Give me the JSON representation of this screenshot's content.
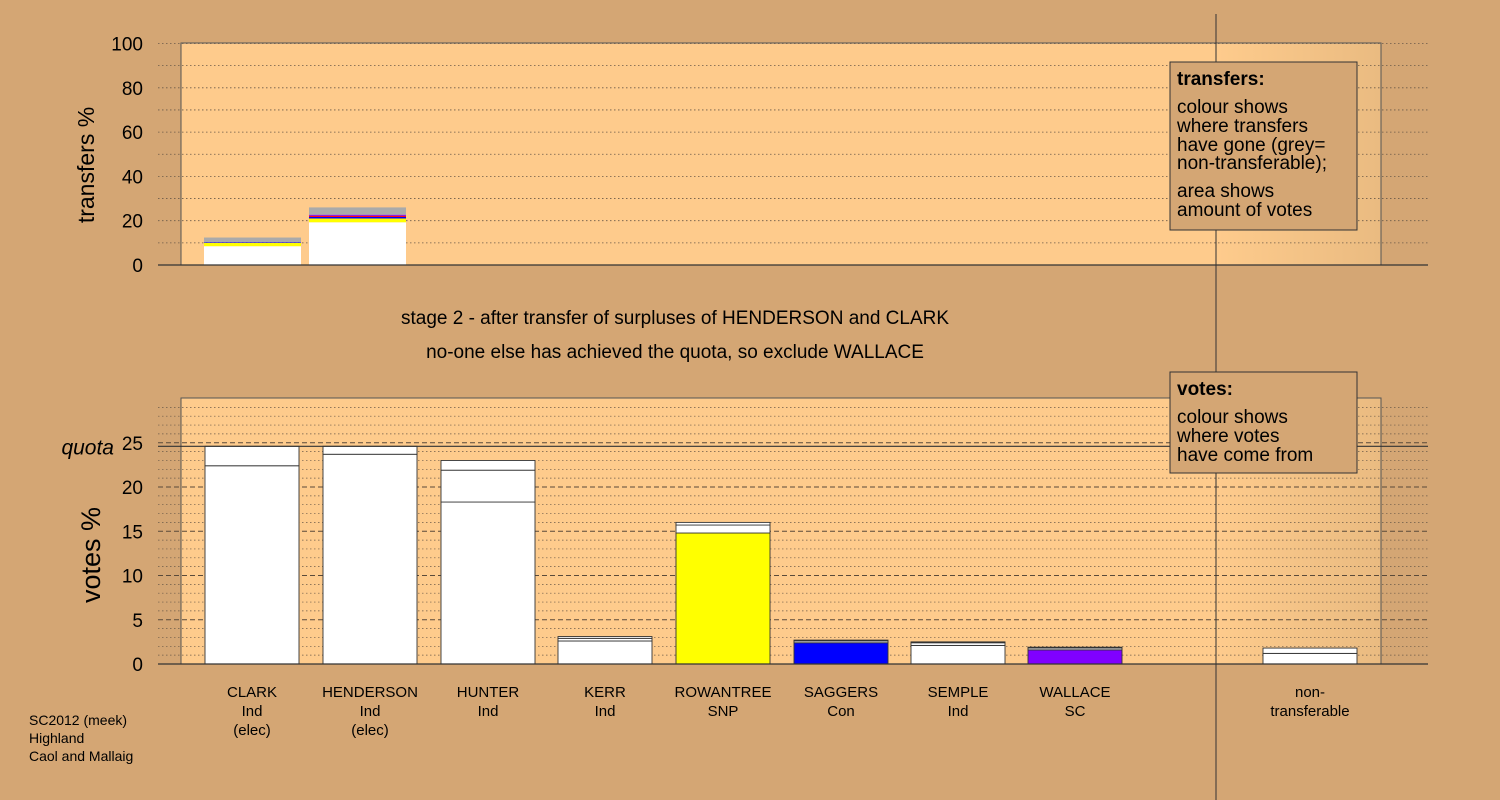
{
  "chart_data": [
    {
      "type": "bar",
      "stacked": true,
      "ylabel": "transfers %",
      "ylim": [
        0,
        100
      ],
      "yticks": [
        0,
        20,
        40,
        60,
        80,
        100
      ],
      "grid": "dotted",
      "categories": [
        "CLARK",
        "HENDERSON"
      ],
      "series": [
        {
          "color": "#ffffff",
          "values": [
            8.5,
            19.3
          ]
        },
        {
          "color": "#ffff00",
          "values": [
            1.5,
            1.7
          ]
        },
        {
          "color": "#0000ff",
          "values": [
            0.3,
            0.7
          ]
        },
        {
          "color": "#ff0000",
          "values": [
            0,
            0.5
          ]
        },
        {
          "color": "#8000ff",
          "values": [
            0,
            0.5
          ]
        },
        {
          "color": "#aaaaaa",
          "values": [
            2.1,
            3.3
          ]
        }
      ],
      "legend": {
        "position": "top-right",
        "title": "transfers:",
        "lines": [
          "colour shows",
          "where transfers",
          "have gone (grey=",
          "non-transferable);",
          "area shows",
          "amount of votes"
        ]
      }
    },
    {
      "type": "bar",
      "stacked": true,
      "ylabel": "votes %",
      "ylim": [
        0,
        25
      ],
      "yticks": [
        0,
        5,
        10,
        15,
        20,
        25
      ],
      "grid": "dashed",
      "quota": {
        "label": "quota",
        "value": 24.6
      },
      "categories": [
        {
          "name": "CLARK",
          "party": "Ind",
          "note": "(elec)"
        },
        {
          "name": "HENDERSON",
          "party": "Ind",
          "note": "(elec)"
        },
        {
          "name": "HUNTER",
          "party": "Ind",
          "note": ""
        },
        {
          "name": "KERR",
          "party": "Ind",
          "note": ""
        },
        {
          "name": "ROWANTREE",
          "party": "SNP",
          "note": ""
        },
        {
          "name": "SAGGERS",
          "party": "Con",
          "note": ""
        },
        {
          "name": "SEMPLE",
          "party": "Ind",
          "note": ""
        },
        {
          "name": "WALLACE",
          "party": "SC",
          "note": ""
        },
        {
          "name": "non-",
          "party": "transferable",
          "note": ""
        }
      ],
      "bars": [
        {
          "color": "#ffffff",
          "segments": [
            22.4,
            2.2
          ]
        },
        {
          "color": "#ffffff",
          "segments": [
            23.7,
            0.9
          ]
        },
        {
          "color": "#ffffff",
          "segments": [
            18.3,
            3.6,
            1.1
          ]
        },
        {
          "color": "#ffffff",
          "segments": [
            2.6,
            0.3,
            0.2
          ]
        },
        {
          "color": "#ffff00",
          "segments": [
            14.8,
            0.9,
            0.3
          ]
        },
        {
          "color": "#0000ff",
          "segments": [
            2.4,
            0.2,
            0.1
          ]
        },
        {
          "color": "#ffffff",
          "segments": [
            2.1,
            0.3,
            0.1
          ]
        },
        {
          "color": "#8000ff",
          "segments": [
            1.6,
            0.2,
            0.1
          ]
        },
        {
          "color": "#ffffff",
          "segments": [
            1.2,
            0.6
          ]
        }
      ],
      "legend": {
        "position": "top-right",
        "title": "votes:",
        "lines": [
          "colour shows",
          "where votes",
          "have come from"
        ]
      }
    }
  ],
  "stage_text": {
    "line1": "stage 2 - after transfer of surpluses of HENDERSON and CLARK",
    "line2": "no-one else has achieved the quota, so exclude WALLACE"
  },
  "footer": {
    "line1": "SC2012 (meek)",
    "line2": "Highland",
    "line3": "Caol and Mallaig"
  },
  "colors": {
    "background": "#d4a674",
    "plot_background": "#fecb8c"
  }
}
